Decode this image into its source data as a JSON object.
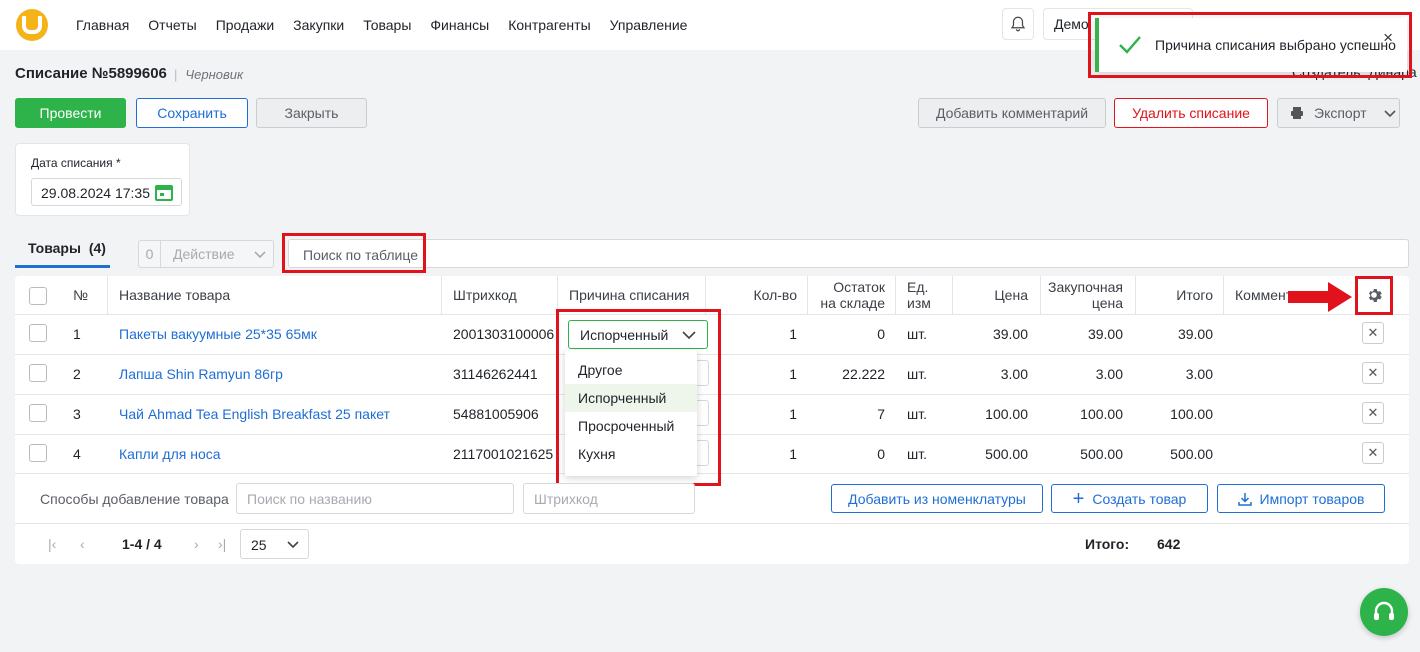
{
  "nav": [
    "Главная",
    "Отчеты",
    "Продажи",
    "Закупки",
    "Товары",
    "Финансы",
    "Контрагенты",
    "Управление"
  ],
  "company": "Демо",
  "toast": {
    "message": "Причина списания выбрано успешно",
    "close": "×"
  },
  "creator": "Создатель: Динара",
  "doc": {
    "title": "Списание №5899606",
    "status": "Черновик"
  },
  "buttons": {
    "submit": "Провести",
    "save": "Сохранить",
    "close": "Закрыть",
    "comment": "Добавить комментарий",
    "delete": "Удалить списание",
    "export": "Экспорт"
  },
  "date": {
    "label": "Дата списания *",
    "value": "29.08.2024 17:35"
  },
  "tab": {
    "label": "Товары",
    "count": "(4)"
  },
  "action": {
    "count": "0",
    "label": "Действие"
  },
  "search": {
    "placeholder": "Поиск по таблице"
  },
  "columns": {
    "num": "№",
    "name": "Название товара",
    "barcode": "Штрихкод",
    "reason": "Причина списания",
    "qty": "Кол-во",
    "stock": "Остаток на складе",
    "unit": "Ед. изм",
    "price": "Цена",
    "purchase": "Закупочная цена",
    "total": "Итого",
    "comment": "Коммент"
  },
  "rows": [
    {
      "num": "1",
      "name": "Пакеты вакуумные 25*35 65мк",
      "barcode": "2001303100006",
      "qty": "1",
      "stock": "0",
      "unit": "шт.",
      "price": "39.00",
      "purchase": "39.00",
      "total": "39.00"
    },
    {
      "num": "2",
      "name": "Лапша Shin Ramyun 86гр",
      "barcode": "31146262441",
      "qty": "1",
      "stock": "22.222",
      "unit": "шт.",
      "price": "3.00",
      "purchase": "3.00",
      "total": "3.00"
    },
    {
      "num": "3",
      "name": "Чай Ahmad Tea English Breakfast 25 пакет",
      "barcode": "54881005906",
      "qty": "1",
      "stock": "7",
      "unit": "шт.",
      "price": "100.00",
      "purchase": "100.00",
      "total": "100.00"
    },
    {
      "num": "4",
      "name": "Капли для носа",
      "barcode": "2117001021625",
      "qty": "1",
      "stock": "0",
      "unit": "шт.",
      "price": "500.00",
      "purchase": "500.00",
      "total": "500.00"
    }
  ],
  "reason_select": {
    "value": "Испорченный",
    "options": [
      "Другое",
      "Испорченный",
      "Просроченный",
      "Кухня"
    ]
  },
  "add_bar": {
    "label": "Способы добавление товара",
    "name_placeholder": "Поиск по названию",
    "barcode_placeholder": "Штрихкод",
    "from_catalog": "Добавить из номенклатуры",
    "create": "Создать товар",
    "import": "Импорт товаров"
  },
  "pager": {
    "range": "1-4 / 4",
    "size": "25"
  },
  "summary": {
    "label": "Итого:",
    "value": "642"
  },
  "colors": {
    "accent": "#1f6ed4",
    "success": "#2db34a",
    "danger": "#e0121b",
    "highlight": "#e0121b"
  }
}
